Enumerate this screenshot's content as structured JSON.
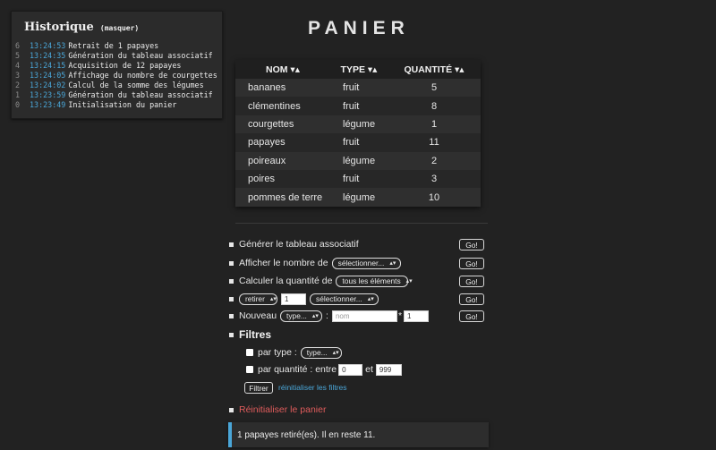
{
  "history": {
    "title": "Historique",
    "toggle": "(masquer)",
    "entries": [
      {
        "index": "6",
        "time": "13:24:53",
        "text": "Retrait de 1 papayes"
      },
      {
        "index": "5",
        "time": "13:24:35",
        "text": "Génération du tableau associatif"
      },
      {
        "index": "4",
        "time": "13:24:15",
        "text": "Acquisition de 12 papayes"
      },
      {
        "index": "3",
        "time": "13:24:05",
        "text": "Affichage du nombre de courgettes"
      },
      {
        "index": "2",
        "time": "13:24:02",
        "text": "Calcul de la somme des légumes"
      },
      {
        "index": "1",
        "time": "13:23:59",
        "text": "Génération du tableau associatif"
      },
      {
        "index": "0",
        "time": "13:23:49",
        "text": "Initialisation du panier"
      }
    ]
  },
  "page_title": "PANIER",
  "table": {
    "headers": {
      "nom": "NOM ▾▴",
      "type": "TYPE ▾▴",
      "qty": "QUANTITÉ ▾▴"
    },
    "rows": [
      {
        "nom": "bananes",
        "type": "fruit",
        "qty": "5"
      },
      {
        "nom": "clémentines",
        "type": "fruit",
        "qty": "8"
      },
      {
        "nom": "courgettes",
        "type": "légume",
        "qty": "1"
      },
      {
        "nom": "papayes",
        "type": "fruit",
        "qty": "11"
      },
      {
        "nom": "poireaux",
        "type": "légume",
        "qty": "2"
      },
      {
        "nom": "poires",
        "type": "fruit",
        "qty": "3"
      },
      {
        "nom": "pommes de terre",
        "type": "légume",
        "qty": "10"
      }
    ]
  },
  "actions": {
    "generate_label": "Générer le tableau associatif",
    "count_label": "Afficher le nombre de",
    "count_select": "sélectionner...",
    "sum_label": "Calculer la quantité de",
    "sum_select": "tous les éléments",
    "remove_mode": "retirer",
    "remove_qty": "1",
    "remove_select": "sélectionner...",
    "new_label": "Nouveau",
    "new_type": "type...",
    "colon": ":",
    "name_placeholder": "nom",
    "times": "*",
    "new_qty": "1",
    "go": "Go!"
  },
  "filters": {
    "title": "Filtres",
    "by_type_label": "par type :",
    "type_select": "type...",
    "by_qty_label": "par quantité : entre",
    "qty_min": "0",
    "and": "et",
    "qty_max": "999",
    "filter_button": "Filtrer",
    "reset_link": "réinitialiser les filtres"
  },
  "reset_basket": "Réinitialiser le panier",
  "notice": "1 papayes retiré(es). Il en reste 11.",
  "colors": {
    "background": "#222222",
    "accent": "#4aa6d8",
    "danger": "#e05c5c"
  }
}
